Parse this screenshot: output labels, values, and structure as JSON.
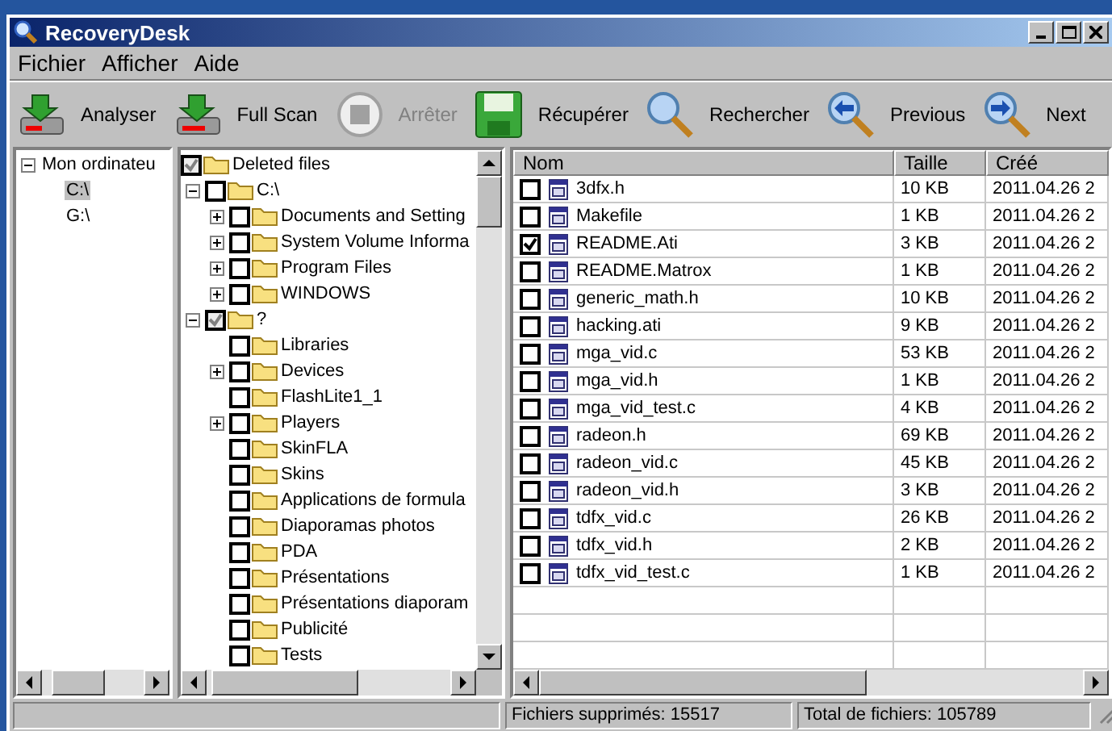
{
  "window": {
    "title": "RecoveryDesk"
  },
  "menu": [
    "Fichier",
    "Afficher",
    "Aide"
  ],
  "toolbar": [
    {
      "kind": "scan",
      "label": "Analyser",
      "disabled": false
    },
    {
      "kind": "fullscan",
      "label": "Full Scan",
      "disabled": false
    },
    {
      "kind": "stop",
      "label": "Arrêter",
      "disabled": true
    },
    {
      "kind": "save",
      "label": "Récupérer",
      "disabled": false
    },
    {
      "kind": "search",
      "label": "Rechercher",
      "disabled": false
    },
    {
      "kind": "previous",
      "label": "Previous",
      "disabled": false
    },
    {
      "kind": "next",
      "label": "Next",
      "disabled": false
    }
  ],
  "drives": {
    "label": "Mon ordinateu",
    "expanded": true,
    "children": [
      {
        "label": "C:\\",
        "selected": true
      },
      {
        "label": "G:\\",
        "selected": false
      }
    ]
  },
  "folders": {
    "label": "Deleted files",
    "checked": true,
    "grayed": true,
    "children": [
      {
        "label": "C:\\",
        "checked": false,
        "grayed": false,
        "expanded": true,
        "children": [
          {
            "label": "Documents and Setting",
            "checked": false,
            "grayed": false,
            "expanded": false
          },
          {
            "label": "System Volume Informa",
            "checked": false,
            "grayed": false,
            "expanded": false
          },
          {
            "label": "Program Files",
            "checked": false,
            "grayed": false,
            "expanded": false
          },
          {
            "label": "WINDOWS",
            "checked": false,
            "grayed": false,
            "expanded": false
          }
        ]
      },
      {
        "label": "?",
        "checked": true,
        "grayed": true,
        "expanded": true,
        "children": [
          {
            "label": "Libraries",
            "checked": false,
            "grayed": false
          },
          {
            "label": "Devices",
            "checked": false,
            "grayed": false,
            "expanded": false
          },
          {
            "label": "FlashLite1_1",
            "checked": false,
            "grayed": false
          },
          {
            "label": "Players",
            "checked": false,
            "grayed": false,
            "expanded": false
          },
          {
            "label": "SkinFLA",
            "checked": false,
            "grayed": false
          },
          {
            "label": "Skins",
            "checked": false,
            "grayed": false
          },
          {
            "label": "Applications de formula",
            "checked": false,
            "grayed": false
          },
          {
            "label": "Diaporamas photos",
            "checked": false,
            "grayed": false
          },
          {
            "label": "PDA",
            "checked": false,
            "grayed": false
          },
          {
            "label": "Présentations",
            "checked": false,
            "grayed": false
          },
          {
            "label": "Présentations diaporam",
            "checked": false,
            "grayed": false
          },
          {
            "label": "Publicité",
            "checked": false,
            "grayed": false
          },
          {
            "label": "Tests",
            "checked": false,
            "grayed": false
          }
        ]
      }
    ]
  },
  "table": {
    "columns": [
      "Nom",
      "Taille",
      "Créé"
    ],
    "rows": [
      {
        "checked": false,
        "name": "3dfx.h",
        "size": "10 KB",
        "created": "2011.04.26 2"
      },
      {
        "checked": false,
        "name": "Makefile",
        "size": "1 KB",
        "created": "2011.04.26 2"
      },
      {
        "checked": true,
        "name": "README.Ati",
        "size": "3 KB",
        "created": "2011.04.26 2"
      },
      {
        "checked": false,
        "name": "README.Matrox",
        "size": "1 KB",
        "created": "2011.04.26 2"
      },
      {
        "checked": false,
        "name": "generic_math.h",
        "size": "10 KB",
        "created": "2011.04.26 2"
      },
      {
        "checked": false,
        "name": "hacking.ati",
        "size": "9 KB",
        "created": "2011.04.26 2"
      },
      {
        "checked": false,
        "name": "mga_vid.c",
        "size": "53 KB",
        "created": "2011.04.26 2"
      },
      {
        "checked": false,
        "name": "mga_vid.h",
        "size": "1 KB",
        "created": "2011.04.26 2"
      },
      {
        "checked": false,
        "name": "mga_vid_test.c",
        "size": "4 KB",
        "created": "2011.04.26 2"
      },
      {
        "checked": false,
        "name": "radeon.h",
        "size": "69 KB",
        "created": "2011.04.26 2"
      },
      {
        "checked": false,
        "name": "radeon_vid.c",
        "size": "45 KB",
        "created": "2011.04.26 2"
      },
      {
        "checked": false,
        "name": "radeon_vid.h",
        "size": "3 KB",
        "created": "2011.04.26 2"
      },
      {
        "checked": false,
        "name": "tdfx_vid.c",
        "size": "26 KB",
        "created": "2011.04.26 2"
      },
      {
        "checked": false,
        "name": "tdfx_vid.h",
        "size": "2 KB",
        "created": "2011.04.26 2"
      },
      {
        "checked": false,
        "name": "tdfx_vid_test.c",
        "size": "1 KB",
        "created": "2011.04.26 2"
      }
    ]
  },
  "status_bar": [
    "Fichiers supprimés: 15517",
    "Total de fichiers: 105789"
  ]
}
